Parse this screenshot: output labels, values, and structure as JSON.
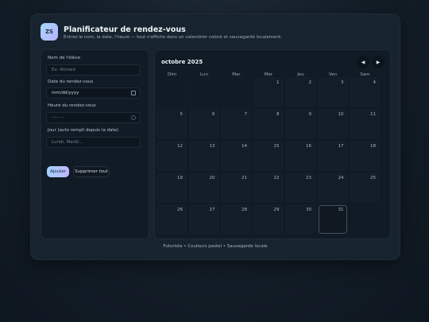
{
  "header": {
    "logo_text": "ZS",
    "title": "Planificateur de rendez-vous",
    "subtitle": "Entrez le nom, la date, l'heure — tout s'affiche dans un calendrier coloré et sauvegardé localement."
  },
  "form": {
    "name_label": "Nom de l'élève",
    "name_placeholder": "Ex: Ahmed",
    "date_label": "Date du rendez-vous",
    "date_value": "mm/dd/yyyy",
    "time_label": "Heure du rendez-vous",
    "time_value": "--:-- --",
    "day_label": "Jour (auto rempli depuis la date)",
    "day_placeholder": "Lundi, Mardi...",
    "add_label": "Ajouter",
    "delete_label": "Supprimer tout"
  },
  "calendar": {
    "month_label": "octobre 2025",
    "prev_label": "◀",
    "next_label": "▶",
    "weekdays": [
      "Dim",
      "Lun",
      "Mar",
      "Mer",
      "Jeu",
      "Ven",
      "Sam"
    ],
    "leading_blanks": 3,
    "days_in_month": 31,
    "highlighted_day": 31
  },
  "footer": {
    "text": "Futuriste • Couleurs pastel • Sauvegarde locale"
  },
  "colors": {
    "accent_start": "#9fd2ff",
    "accent_end": "#c2b6ff",
    "background": "#101a24",
    "panel": "#111b25"
  }
}
